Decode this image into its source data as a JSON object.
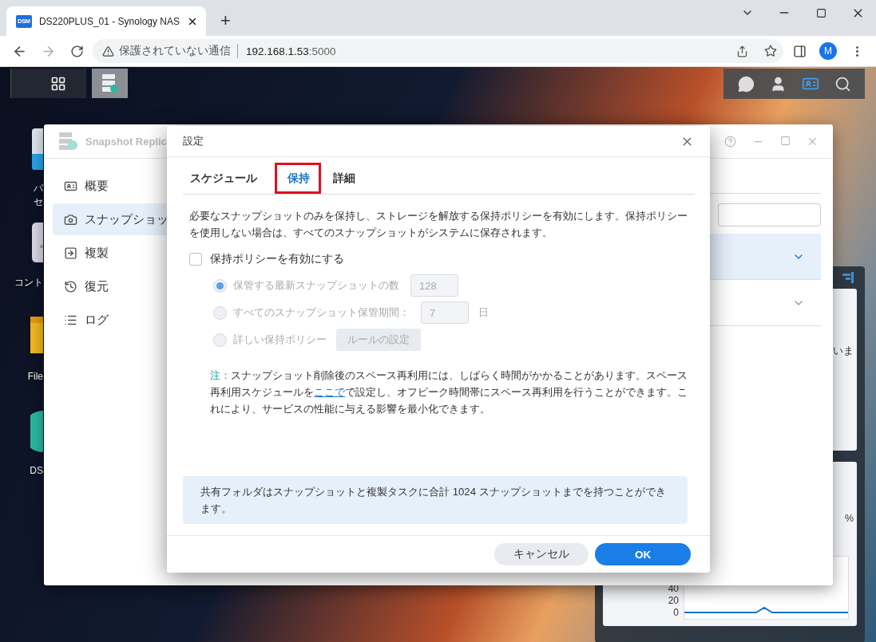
{
  "browser": {
    "favicon": "DSM",
    "tab_title": "DS220PLUS_01 - Synology NAS",
    "new_tab": "+",
    "security_label": "保護されていない通信",
    "url_host": "192.168.1.53",
    "url_port": ":5000",
    "profile": "M"
  },
  "desktop_icons": [
    {
      "kind": "package",
      "lines": [
        "パ",
        "セ"
      ]
    },
    {
      "kind": "control",
      "lines": [
        "コント"
      ]
    },
    {
      "kind": "folder",
      "lines": [
        "File"
      ]
    },
    {
      "kind": "disc",
      "lines": [
        "DS"
      ]
    }
  ],
  "widget": {
    "card_text": "いま",
    "percent": "%",
    "chart_ticks": [
      "40",
      "20",
      "0"
    ]
  },
  "app_window": {
    "title": "Snapshot Replic",
    "nav": [
      {
        "kind": "overview",
        "label": "概要",
        "selected": false
      },
      {
        "kind": "snapshot",
        "label": "スナップショッ",
        "selected": true
      },
      {
        "kind": "replication",
        "label": "複製",
        "selected": false
      },
      {
        "kind": "restore",
        "label": "復元",
        "selected": false
      },
      {
        "kind": "log",
        "label": "ログ",
        "selected": false
      }
    ],
    "rows": [
      {
        "selected": true
      },
      {
        "selected": false
      }
    ]
  },
  "dialog": {
    "title": "設定",
    "tabs": [
      {
        "label": "スケジュール",
        "selected": false,
        "highlighted": false
      },
      {
        "label": "保持",
        "selected": true,
        "highlighted": true
      },
      {
        "label": "詳細",
        "selected": false,
        "highlighted": false
      }
    ],
    "description": "必要なスナップショットのみを保持し、ストレージを解放する保持ポリシーを有効にします。保持ポリシーを使用しない場合は、すべてのスナップショットがシステムに保存されます。",
    "enable_policy": {
      "label": "保持ポリシーを有効にする",
      "checked": false
    },
    "options": [
      {
        "kind": "count",
        "label": "保管する最新スナップショットの数",
        "selected": true,
        "disabled": true,
        "value": "128"
      },
      {
        "kind": "days",
        "label": "すべてのスナップショット保管期間：",
        "selected": false,
        "disabled": true,
        "value": "7",
        "unit": "日"
      },
      {
        "kind": "rules",
        "label": "詳しい保持ポリシー",
        "selected": false,
        "disabled": true,
        "button": "ルールの設定"
      }
    ],
    "note": {
      "label": "注：",
      "text_before": "スナップショット削除後のスペース再利用には、しばらく時間がかかることがあります。スペース再利用スケジュールを",
      "link": "ここで",
      "text_after": "で設定し、オフピーク時間帯にスペース再利用を行うことができます。これにより、サービスの性能に与える影響を最小化できます。"
    },
    "info": "共有フォルダはスナップショットと複製タスクに合計 1024 スナップショットまでを持つことができます。",
    "buttons": [
      {
        "kind": "secondary",
        "label": "キャンセル"
      },
      {
        "kind": "primary",
        "label": "OK"
      }
    ]
  }
}
